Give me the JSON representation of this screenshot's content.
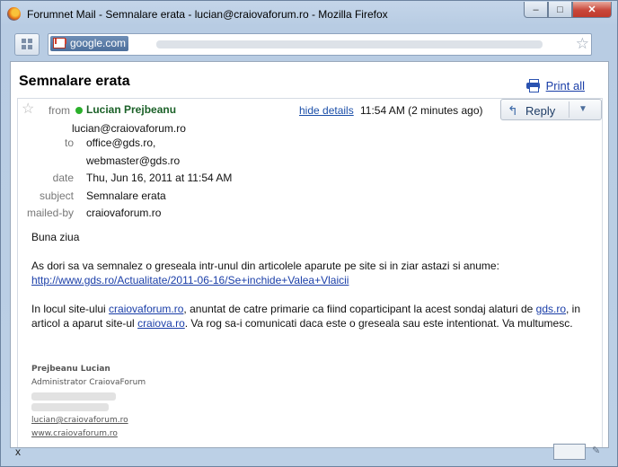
{
  "window": {
    "title": "Forumnet Mail - Semnalare erata - lucian@craiovaforum.ro - Mozilla Firefox",
    "controls": {
      "minimize": "–",
      "maximize": "□",
      "close": "✕"
    }
  },
  "nav": {
    "site_label": "google.com",
    "bookmark_icon": "star-icon"
  },
  "email": {
    "subject": "Semnalare erata",
    "print_all": "Print all",
    "from_label": "from",
    "sender_name": "Lucian Prejbeanu",
    "sender_email": "lucian@craiovaforum.ro",
    "hide_details": "hide details",
    "time": "11:54 AM (2 minutes ago)",
    "reply_label": "Reply",
    "reply_arrow": "↰",
    "reply_dropdown": "▼",
    "meta": {
      "to_label": "to",
      "to_1": "office@gds.ro,",
      "to_2": "webmaster@gds.ro",
      "date_label": "date",
      "date": "Thu, Jun 16, 2011 at 11:54 AM",
      "subject_label": "subject",
      "subject": "Semnalare erata",
      "mailedby_label": "mailed-by",
      "mailedby": "craiovaforum.ro"
    },
    "body": {
      "greeting": "Buna ziua",
      "p1": "As dori sa va semnalez o greseala intr-unul din articolele aparute pe site si in ziar astazi si anume:",
      "link1": "http://www.gds.ro/Actualitate/2011-06-16/Se+inchide+Valea+Vlaicii",
      "p2_a": "In locul site-ului ",
      "p2_link1": "craiovaforum.ro",
      "p2_b": ", anuntat de catre primarie ca fiind coparticipant la acest sondaj alaturi de ",
      "p2_link2": "gds.ro",
      "p2_c": ", in articol a aparut site-ul ",
      "p2_link3": "craiova.ro",
      "p2_d": ". Va rog sa-i comunicati daca este o greseala sau este intentionat. Va multumesc."
    },
    "signature": {
      "name": "Prejbeanu Lucian",
      "title": "Administrator CraiovaForum",
      "email": "lucian@craiovaforum.ro",
      "website": "www.craiovaforum.ro"
    }
  },
  "status": {
    "close": "x"
  }
}
